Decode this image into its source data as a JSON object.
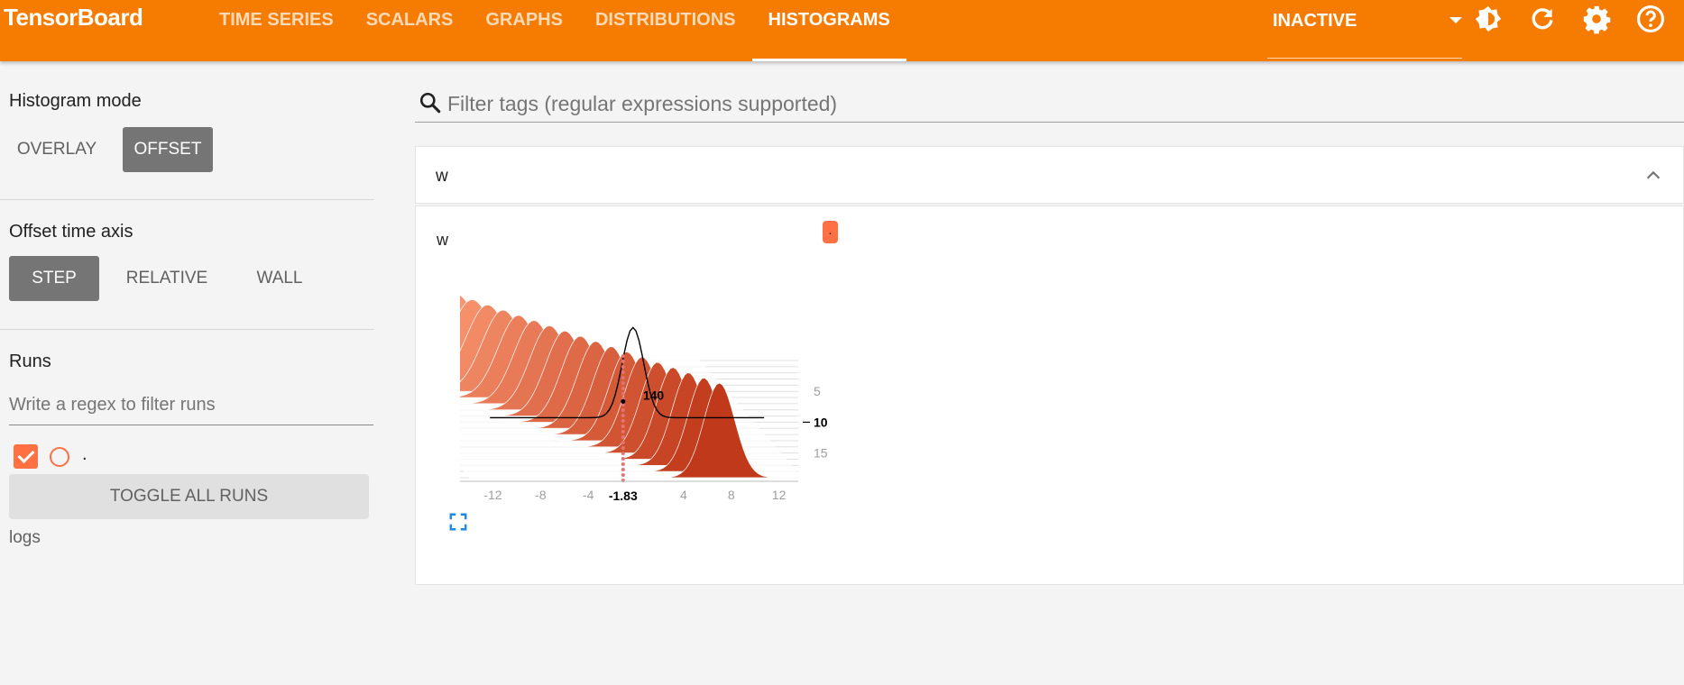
{
  "app": {
    "title": "TensorBoard",
    "brand_color": "#f57c00"
  },
  "nav": {
    "tabs": [
      "TIME SERIES",
      "SCALARS",
      "GRAPHS",
      "DISTRIBUTIONS",
      "HISTOGRAMS"
    ],
    "active_tab": "HISTOGRAMS",
    "status": "INACTIVE",
    "icons": [
      "theme-icon",
      "refresh-icon",
      "settings-icon",
      "help-icon"
    ]
  },
  "sidebar": {
    "histogram_mode": {
      "title": "Histogram mode",
      "options": [
        "OVERLAY",
        "OFFSET"
      ],
      "selected": "OFFSET"
    },
    "time_axis": {
      "title": "Offset time axis",
      "options": [
        "STEP",
        "RELATIVE",
        "WALL"
      ],
      "selected": "STEP"
    },
    "runs": {
      "title": "Runs",
      "filter_placeholder": "Write a regex to filter runs",
      "items": [
        {
          "name": ".",
          "checked": true,
          "color": "#ff7043"
        }
      ],
      "toggle_all_label": "TOGGLE ALL RUNS",
      "footer": "logs"
    }
  },
  "main": {
    "filter_placeholder": "Filter tags (regular expressions supported)",
    "card": {
      "tag": "w",
      "chart_title": "w",
      "run_chip": "."
    }
  },
  "chart_data": {
    "type": "histogram-offset",
    "title": "w",
    "x_ticks": [
      -12,
      -8,
      -4,
      4,
      8,
      12
    ],
    "y_ticks": [
      5,
      10,
      15
    ],
    "step_range": [
      0,
      19
    ],
    "hover": {
      "step": 10,
      "x": -1.83,
      "count": 140
    },
    "palette": [
      "#ffa07a",
      "#c0391a"
    ]
  }
}
